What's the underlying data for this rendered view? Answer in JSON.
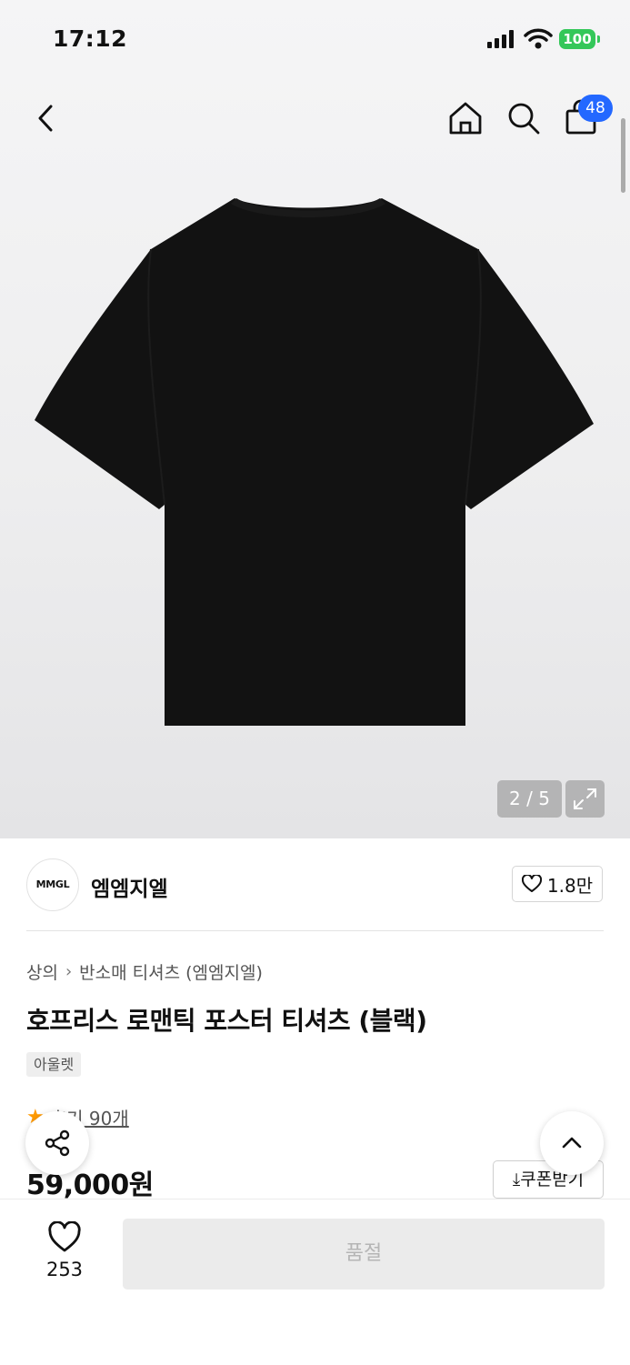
{
  "status_bar": {
    "time": "17:12",
    "battery": "100"
  },
  "header": {
    "back_icon": "chevron-left-icon",
    "home_icon": "home-icon",
    "search_icon": "search-icon",
    "bag_icon": "shopping-bag-icon",
    "cart_count": "48"
  },
  "gallery": {
    "counter": "2 / 5",
    "expand_icon": "expand-icon"
  },
  "brand": {
    "logo_text": "MMGL",
    "name": "엠엠지엘",
    "favorites": "1.8만"
  },
  "product": {
    "breadcrumb": [
      "상의",
      "반소매 티셔츠 (엠엠지엘)"
    ],
    "title": "호프리스 로맨틱 포스터 티셔츠 (블랙)",
    "tag": "아울렛",
    "rating_text": "후기 90개",
    "price": "59,000원",
    "coupon_label": "쿠폰받기"
  },
  "bottom_bar": {
    "like_count": "253",
    "buy_label": "품절"
  },
  "colors": {
    "badge": "#2368ff",
    "star": "#ff9a00",
    "battery": "#34c759"
  }
}
